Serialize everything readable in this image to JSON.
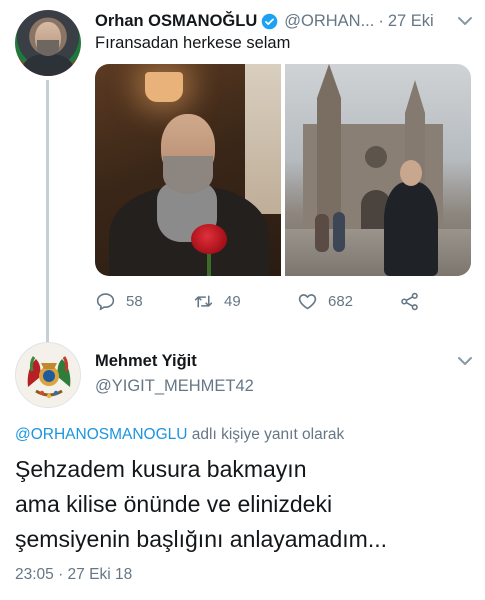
{
  "tweet": {
    "author_name": "Orhan OSMANOĞLU",
    "handle": "@ORHAN...",
    "separator": "·",
    "date": "27 Eki",
    "text": "Fıransadan herkese selam",
    "replies": "58",
    "retweets": "49",
    "likes": "682"
  },
  "reply": {
    "author_name": "Mehmet Yiğit",
    "handle": "@YIGIT_MEHMET42",
    "reply_to_handle": "@ORHANOSMANOGLU",
    "reply_to_suffix": " adlı kişiye yanıt olarak",
    "text_lines": [
      "Şehzadem kusura bakmayın",
      "ama kilise önünde ve elinizdeki",
      "şemsiyenin başlığını anlayamadım..."
    ],
    "timestamp": "23:05 · 27 Eki 18"
  },
  "colors": {
    "link": "#1b95e0",
    "secondary_text": "#657786",
    "thread_line": "#c4cfd6",
    "verified": "#1da1f2"
  }
}
